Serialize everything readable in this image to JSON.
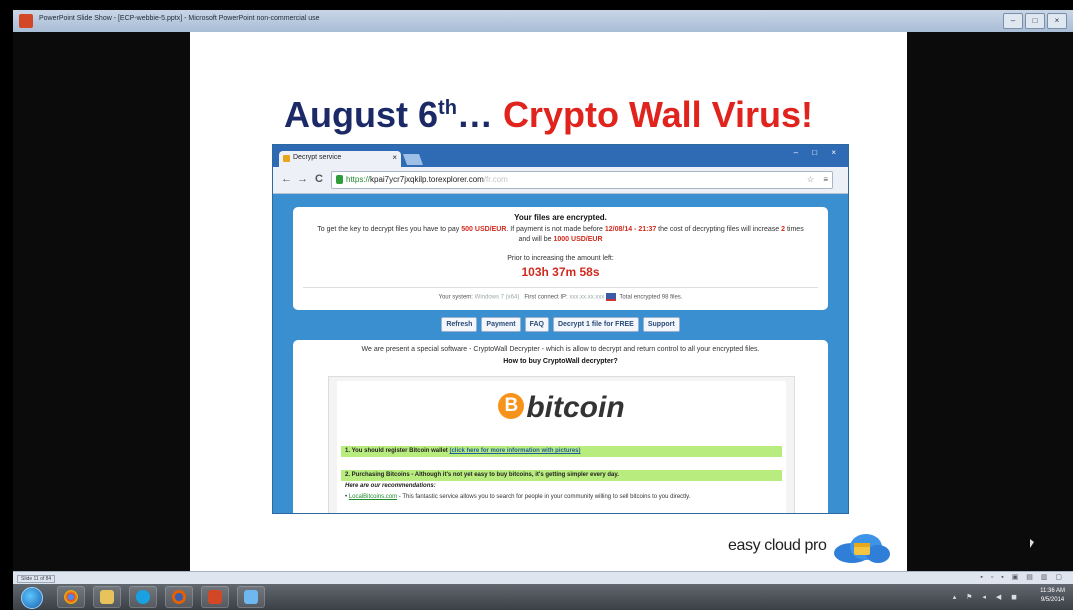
{
  "window": {
    "title": "PowerPoint Slide Show - [ECP-webbie-5.pptx] - Microsoft PowerPoint non-commercial use",
    "controls": [
      "–",
      "□",
      "×"
    ]
  },
  "slide": {
    "title_part1": "August 6",
    "title_sup": "th",
    "title_part2": "… ",
    "title_part3": "Crypto Wall Virus!",
    "brand": "easy cloud pro"
  },
  "browser": {
    "tab_label": "Decrypt service",
    "tab_close": "×",
    "window_controls": "– □ ×",
    "nav": {
      "back": "←",
      "forward": "→",
      "reload": "C"
    },
    "url_scheme": "https://",
    "url_host": "kpai7ycr7jxqkilp.torexplorer.com",
    "url_path": "/fr.com",
    "star": "☆",
    "menu": "≡"
  },
  "ransom": {
    "heading": "Your files are encrypted.",
    "line_a": "To get the key to decrypt files you have to pay ",
    "amount": "500 USD/EUR",
    "line_b": ". If payment is not made before ",
    "deadline": "12/08/14 - 21:37",
    "line_c": " the cost of decrypting files will increase ",
    "multiplier": "2",
    "line_d": " times and will be ",
    "amount2": "1000 USD/EUR",
    "prior": "Prior to increasing the amount left:",
    "timer": "103h 37m 58s",
    "system_label": "Your system: ",
    "system_value": "Windows 7 (x64)",
    "ip_label": "First connect IP: ",
    "ip_value": "xxx.xx.xx.xxx",
    "encrypted_label": "Total encrypted ",
    "encrypted_count": "98",
    "encrypted_suffix": " files."
  },
  "buttons": [
    "Refresh",
    "Payment",
    "FAQ",
    "Decrypt 1 file for FREE",
    "Support"
  ],
  "payment": {
    "intro": "We are present a special software - CryptoWall Decrypter - which is allow to decrypt and return control to all your encrypted files.",
    "how_to": "How to buy CryptoWall decrypter?",
    "bitcoin_symbol": "B",
    "bitcoin_word": "bitcoin",
    "step1_text": "1. You should register Bitcoin wallet ",
    "step1_link": "(click here for more information with pictures)",
    "step2_text": "2. Purchasing Bitcoins - Although it's not yet easy to buy bitcoins, it's getting simpler every day.",
    "recommendations": "Here are our recommendations:",
    "bullet_link": "LocalBitcoins.com",
    "bullet_text": " - This fantastic service allows you to search for people in your community willing to sell bitcoins to you directly."
  },
  "statusbar": {
    "slide_number": "Slide 11 of 84",
    "views": "▪ ▫ ▪ ▣ ▤ ▥ ▢"
  },
  "taskbar": {
    "tray": "▴ ⚑ ◂ ◀ ◼",
    "time": "11:36 AM",
    "date": "9/5/2014"
  },
  "colors": {
    "title_blue": "#1b2a66",
    "title_red": "#e0231c",
    "browser_blue": "#3a8fd0",
    "ransom_red": "#d12a1e",
    "step_green": "#b9ec7e",
    "bitcoin_orange": "#f7931a"
  }
}
